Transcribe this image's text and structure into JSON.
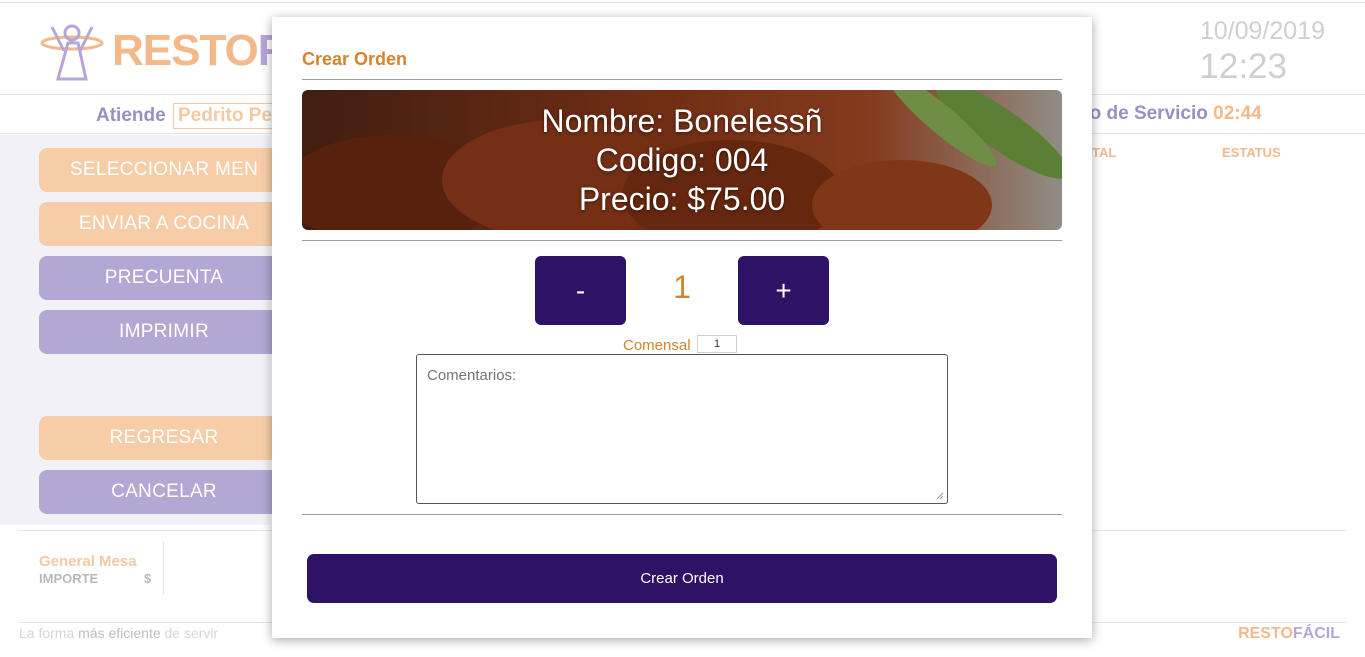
{
  "app": {
    "logo": {
      "part1": "RESTO",
      "part2": "FÁ"
    },
    "date": "10/09/2019",
    "time": "12:23"
  },
  "info_bar": {
    "attends_label": "Atiende",
    "attends_name": "Pedrito Pe",
    "service_label": "po de Servicio",
    "service_time": "02:44"
  },
  "sidebar": {
    "buttons": [
      {
        "label": "SELECCIONAR MEN"
      },
      {
        "label": "ENVIAR A COCINA"
      },
      {
        "label": "PRECUENTA"
      },
      {
        "label": "IMPRIMIR"
      },
      {
        "label": "REGRESAR"
      },
      {
        "label": "CANCELAR"
      }
    ]
  },
  "table": {
    "columns": [
      "TAL",
      "ESTATUS"
    ]
  },
  "summary": {
    "title": "General Mesa",
    "importe_label": "IMPORTE",
    "currency": "$"
  },
  "footer": {
    "tagline_start": "La forma ",
    "tagline_em": "más eficiente",
    "tagline_end": " de servir",
    "logo_part1": "RESTO",
    "logo_part2": "FÁCIL"
  },
  "modal": {
    "title": "Crear Orden",
    "product": {
      "name_line": "Nombre: Bonelessñ",
      "code_line": "Codigo: 004",
      "price_line": "Precio: $75.00"
    },
    "quantity": {
      "minus_label": "-",
      "value": "1",
      "plus_label": "+"
    },
    "comensal": {
      "label": "Comensal",
      "value": "1"
    },
    "comments": {
      "placeholder": "Comentarios:"
    },
    "submit_label": "Crear Orden"
  },
  "colors": {
    "accent_orange": "#d4842f",
    "primary_purple": "#2d1265",
    "soft_orange": "#f7cda8",
    "soft_purple": "#b3a7d3"
  }
}
